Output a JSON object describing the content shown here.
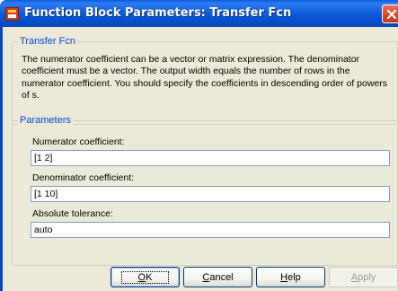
{
  "window": {
    "title": "Function Block Parameters: Transfer Fcn",
    "close_label": "X"
  },
  "description_group": {
    "title": "Transfer Fcn",
    "text": "The numerator coefficient can be a vector or matrix expression. The denominator coefficient must be a vector. The output width equals the number of rows in the numerator coefficient. You should specify the coefficients in descending order of powers of s."
  },
  "parameters_group": {
    "title": "Parameters",
    "fields": [
      {
        "label": "Numerator coefficient:",
        "value": "[1 2]"
      },
      {
        "label": "Denominator coefficient:",
        "value": "[1 10]"
      },
      {
        "label": "Absolute tolerance:",
        "value": "auto"
      }
    ]
  },
  "buttons": {
    "ok": {
      "label": "OK",
      "mnemonic": "O",
      "rest": "K"
    },
    "cancel": {
      "label": "Cancel",
      "mnemonic": "C",
      "rest": "ancel"
    },
    "help": {
      "label": "Help",
      "mnemonic": "H",
      "rest": "elp"
    },
    "apply": {
      "label": "Apply",
      "mnemonic": "A",
      "rest": "pply"
    }
  },
  "icons": {
    "title_icon": "simulink-block-icon",
    "close_icon": "close-icon"
  },
  "colors": {
    "titlebar": "#0a58d8",
    "dialog_bg": "#ece9d8",
    "group_title": "#0046d5",
    "close_button": "#d7451f"
  }
}
